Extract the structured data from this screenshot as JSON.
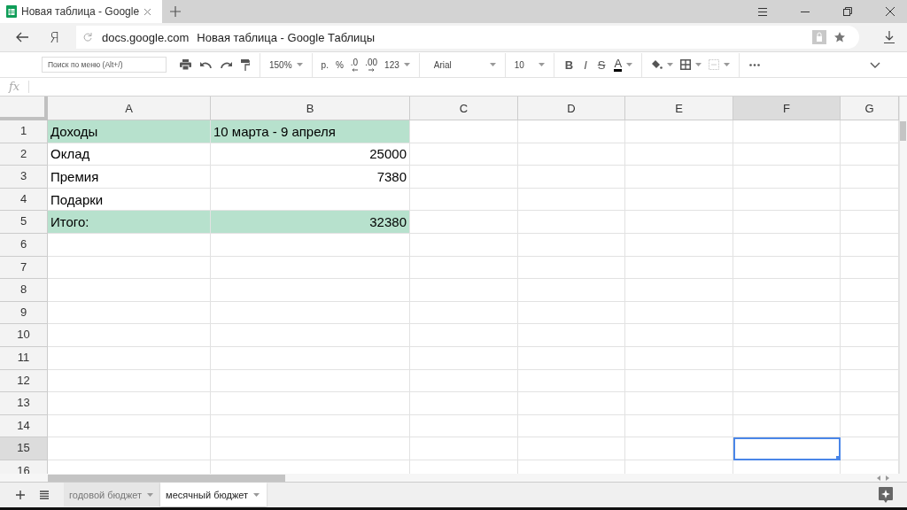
{
  "browser": {
    "tab_title": "Новая таблица - Google",
    "logo": "Я",
    "domain": "docs.google.com",
    "page_title": "Новая таблица - Google Таблицы"
  },
  "toolbar": {
    "search": {
      "placeholder": "Поиск по меню (Alt+/)"
    },
    "zoom": "150%",
    "currency": "р.",
    "percent": "%",
    "decrease_decimals": ".0",
    "increase_decimals": ".00",
    "number_format": "123",
    "font": "Arial",
    "font_size": "10",
    "bold": "B",
    "italic": "I",
    "strikethrough": "S",
    "text_color": "A"
  },
  "formula_bar": {
    "label": "fx"
  },
  "columns": [
    {
      "label": "A",
      "selected": false
    },
    {
      "label": "B",
      "selected": false
    },
    {
      "label": "C",
      "selected": false
    },
    {
      "label": "D",
      "selected": false
    },
    {
      "label": "E",
      "selected": false
    },
    {
      "label": "F",
      "selected": true
    },
    {
      "label": "G",
      "selected": false
    }
  ],
  "rows": [
    {
      "number": "1",
      "selected": false,
      "cells": [
        {
          "kind": "text",
          "text": "Доходы",
          "highlighted": true
        },
        {
          "kind": "text",
          "text": "10 марта - 9 апреля",
          "highlighted": true
        }
      ]
    },
    {
      "number": "2",
      "selected": false,
      "cells": [
        {
          "kind": "text",
          "text": "Оклад",
          "highlighted": false
        },
        {
          "kind": "number",
          "text": "25000",
          "highlighted": false
        }
      ]
    },
    {
      "number": "3",
      "selected": false,
      "cells": [
        {
          "kind": "text",
          "text": "Премия",
          "highlighted": false
        },
        {
          "kind": "number",
          "text": "7380",
          "highlighted": false
        }
      ]
    },
    {
      "number": "4",
      "selected": false,
      "cells": [
        {
          "kind": "text",
          "text": "Подарки",
          "highlighted": false
        },
        {
          "kind": "number",
          "highlighted": false
        }
      ]
    },
    {
      "number": "5",
      "selected": false,
      "cells": [
        {
          "kind": "text",
          "text": "Итого:",
          "highlighted": true
        },
        {
          "kind": "number",
          "text": "32380",
          "highlighted": true
        }
      ]
    },
    {
      "number": "6",
      "selected": false
    },
    {
      "number": "7",
      "selected": false
    },
    {
      "number": "8",
      "selected": false
    },
    {
      "number": "9",
      "selected": false
    },
    {
      "number": "10",
      "selected": false
    },
    {
      "number": "11",
      "selected": false
    },
    {
      "number": "12",
      "selected": false
    },
    {
      "number": "13",
      "selected": false
    },
    {
      "number": "14",
      "selected": false
    },
    {
      "number": "15",
      "selected": true
    },
    {
      "number": "16",
      "selected": false
    }
  ],
  "sheets": [
    {
      "label": "годовой бюджет",
      "selected": false
    },
    {
      "label": "месячный бюджет",
      "selected": true
    }
  ]
}
